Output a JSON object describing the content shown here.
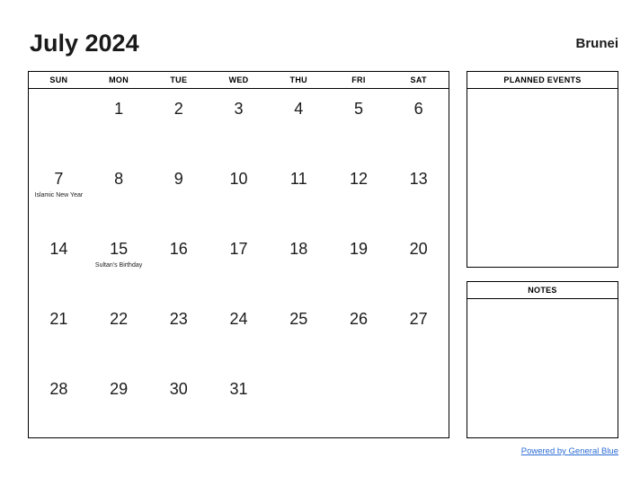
{
  "header": {
    "month_title": "July 2024",
    "country": "Brunei"
  },
  "calendar": {
    "weekdays": [
      "SUN",
      "MON",
      "TUE",
      "WED",
      "THU",
      "FRI",
      "SAT"
    ],
    "weeks": [
      [
        {
          "day": "",
          "event": ""
        },
        {
          "day": "1",
          "event": ""
        },
        {
          "day": "2",
          "event": ""
        },
        {
          "day": "3",
          "event": ""
        },
        {
          "day": "4",
          "event": ""
        },
        {
          "day": "5",
          "event": ""
        },
        {
          "day": "6",
          "event": ""
        }
      ],
      [
        {
          "day": "7",
          "event": "Islamic New Year"
        },
        {
          "day": "8",
          "event": ""
        },
        {
          "day": "9",
          "event": ""
        },
        {
          "day": "10",
          "event": ""
        },
        {
          "day": "11",
          "event": ""
        },
        {
          "day": "12",
          "event": ""
        },
        {
          "day": "13",
          "event": ""
        }
      ],
      [
        {
          "day": "14",
          "event": ""
        },
        {
          "day": "15",
          "event": "Sultan's Birthday"
        },
        {
          "day": "16",
          "event": ""
        },
        {
          "day": "17",
          "event": ""
        },
        {
          "day": "18",
          "event": ""
        },
        {
          "day": "19",
          "event": ""
        },
        {
          "day": "20",
          "event": ""
        }
      ],
      [
        {
          "day": "21",
          "event": ""
        },
        {
          "day": "22",
          "event": ""
        },
        {
          "day": "23",
          "event": ""
        },
        {
          "day": "24",
          "event": ""
        },
        {
          "day": "25",
          "event": ""
        },
        {
          "day": "26",
          "event": ""
        },
        {
          "day": "27",
          "event": ""
        }
      ],
      [
        {
          "day": "28",
          "event": ""
        },
        {
          "day": "29",
          "event": ""
        },
        {
          "day": "30",
          "event": ""
        },
        {
          "day": "31",
          "event": ""
        },
        {
          "day": "",
          "event": ""
        },
        {
          "day": "",
          "event": ""
        },
        {
          "day": "",
          "event": ""
        }
      ]
    ]
  },
  "panels": {
    "planned_events": {
      "title": "PLANNED EVENTS",
      "content": ""
    },
    "notes": {
      "title": "NOTES",
      "content": ""
    }
  },
  "footer": {
    "link_text": "Powered by General Blue",
    "link_color": "#2b6cd4"
  }
}
